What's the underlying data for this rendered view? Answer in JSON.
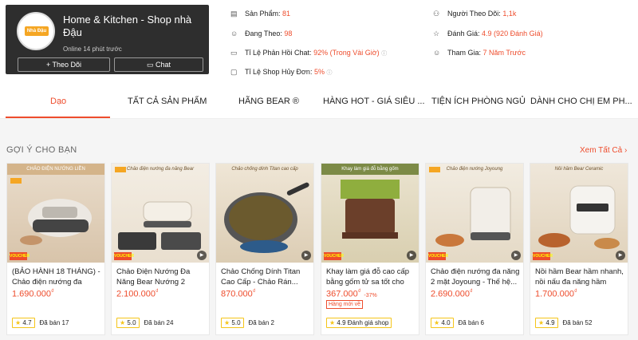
{
  "shop": {
    "avatar_text": "Nhà Đậu",
    "name": "Home & Kitchen - Shop nhà Đậu",
    "online": "Online 14 phút trước",
    "follow_label": "Theo Dõi",
    "chat_label": "Chat"
  },
  "stats": {
    "products_label": "Sản Phẩm:",
    "products_value": "81",
    "following_label": "Đang Theo:",
    "following_value": "98",
    "response_label": "Tỉ Lệ Phản Hồi Chat:",
    "response_value": "92% (Trong Vài Giờ)",
    "cancel_label": "Tỉ Lệ Shop Hủy Đơn:",
    "cancel_value": "5%",
    "followers_label": "Người Theo Dõi:",
    "followers_value": "1,1k",
    "rating_label": "Đánh Giá:",
    "rating_value": "4.9 (920 Đánh Giá)",
    "joined_label": "Tham Gia:",
    "joined_value": "7 Năm Trước"
  },
  "tabs": [
    "Dạo",
    "TẤT CẢ SẢN PHẨM",
    "HÃNG BEAR ®",
    "HÀNG HOT - GIÁ SIÊU ...",
    "TIỆN ÍCH PHÒNG NGỦ",
    "DÀNH CHO CHỊ EM PH..."
  ],
  "section": {
    "title": "GỢI Ý CHO BẠN",
    "see_all": "Xem Tất Cả"
  },
  "products": [
    {
      "title": "(BẢO HÀNH 18 THÁNG) - Chảo điện nướng đa năn...",
      "price": "1.690.000",
      "rating": "4.7",
      "sold": "Đã bán 17",
      "img_caption": "CHẢO ĐIỆN NƯỚNG LIỀN"
    },
    {
      "title": "Chảo Điện Nướng Đa Năng Bear Nướng 2 Mặt...",
      "price": "2.100.000",
      "rating": "5.0",
      "sold": "Đã bán 24",
      "img_caption": "Chảo điện nướng đa năng Bear"
    },
    {
      "title": "Chảo Chống Dính Titan Cao Cấp - Chảo Rán...",
      "price": "870.000",
      "rating": "5.0",
      "sold": "Đã bán 2",
      "img_caption": "Chảo chống dính Titan cao cấp"
    },
    {
      "title": "Khay làm giá đỗ cao cấp bằng gốm tử sa tốt cho s...",
      "price": "367.000",
      "discount": "-37%",
      "cheap": "Hàng mới về",
      "rating": "4.9",
      "sold": "Đánh giá shop",
      "img_caption": "Khay làm giá đỗ bằng gốm"
    },
    {
      "title": "Chảo điện nướng đa năng 2 mặt Joyoung - Thế hệ...",
      "price": "2.690.000",
      "rating": "4.0",
      "sold": "Đã bán 6",
      "img_caption": "Chảo điện nướng Joyoung"
    },
    {
      "title": "Nồi hầm Bear hầm nhanh, nồi nấu đa năng hầm chá...",
      "price": "1.700.000",
      "rating": "4.9",
      "sold": "Đã bán 52",
      "img_caption": "Nồi hầm Bear Ceramic"
    }
  ],
  "currency": "₫",
  "voucher": "VOUCHER"
}
